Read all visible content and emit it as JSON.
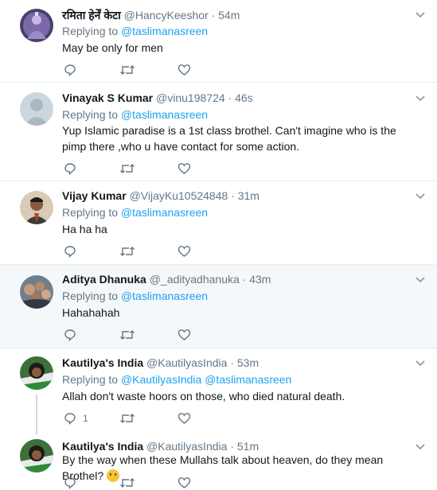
{
  "tweets": [
    {
      "name": "रमिता हेर्नें केटा",
      "handle": "@HancyKeeshor",
      "time": "54m",
      "replying_label": "Replying to",
      "mentions": [
        "@taslimanasreen"
      ],
      "text": "May be only for men",
      "reply_count": "",
      "avatar": "shiva-avatar"
    },
    {
      "name": "Vinayak S Kumar",
      "handle": "@vinu198724",
      "time": "46s",
      "replying_label": "Replying to",
      "mentions": [
        "@taslimanasreen"
      ],
      "text": "Yup Islamic paradise is a 1st class brothel. Can't imagine who is the pimp there ,who u have contact for some action.",
      "reply_count": "",
      "avatar": "default-avatar"
    },
    {
      "name": "Vijay Kumar",
      "handle": "@VijayKu10524848",
      "time": "31m",
      "replying_label": "Replying to",
      "mentions": [
        "@taslimanasreen"
      ],
      "text": "Ha ha ha",
      "reply_count": "",
      "avatar": "man-photo-avatar"
    },
    {
      "name": "Aditya Dhanuka",
      "handle": "@_adityadhanuka",
      "time": "43m",
      "replying_label": "Replying to",
      "mentions": [
        "@taslimanasreen"
      ],
      "text": "Hahahahah",
      "reply_count": "",
      "avatar": "group-photo-avatar"
    },
    {
      "name": "Kautilya's India",
      "handle": "@KautilyasIndia",
      "time": "53m",
      "replying_label": "Replying to",
      "mentions": [
        "@KautilyasIndia",
        "@taslimanasreen"
      ],
      "text": "Allah don't waste hoors on those, who died natural death.",
      "reply_count": "1",
      "avatar": "kautilya-avatar"
    },
    {
      "name": "Kautilya's India",
      "handle": "@KautilyasIndia",
      "time": "51m",
      "text": "By the way when these Mullahs talk about heaven, do they mean Brothel?",
      "emoji": "thinking-face-emoji",
      "avatar": "kautilya-avatar"
    }
  ],
  "icons": {
    "reply": "reply-icon",
    "retweet": "retweet-icon",
    "like": "heart-icon",
    "more": "chevron-down-icon"
  },
  "colors": {
    "link": "#1da1f2",
    "muted": "#657786",
    "highlight_bg": "#f5f8fa"
  }
}
